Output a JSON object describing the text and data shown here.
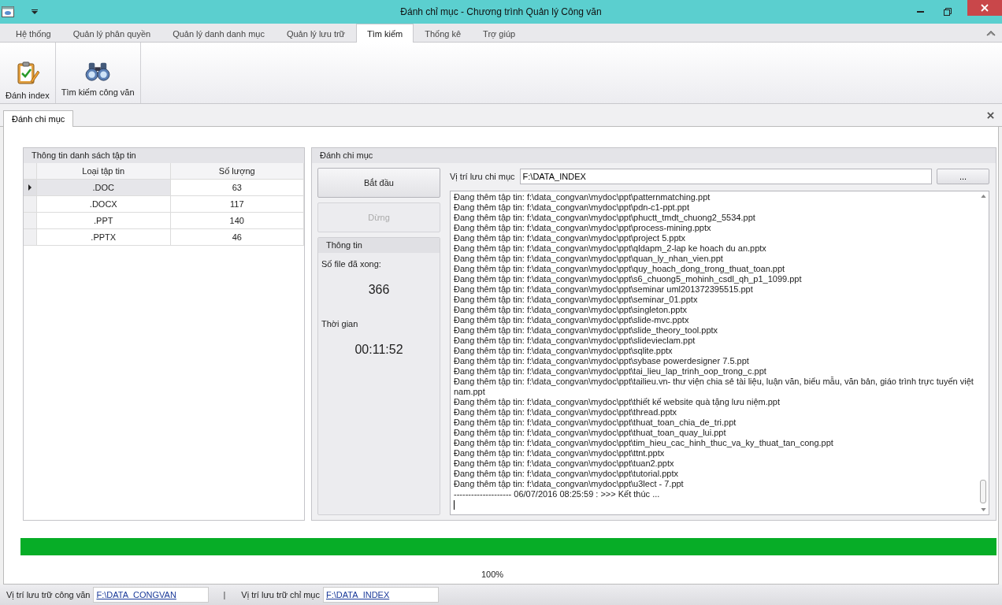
{
  "window": {
    "title": "Đánh chỉ mục - Chương trình Quản lý Công văn"
  },
  "menu_tabs": [
    {
      "label": "Hệ thống",
      "selected": false
    },
    {
      "label": "Quản lý phân quyền",
      "selected": false
    },
    {
      "label": "Quản lý danh danh mục",
      "selected": false
    },
    {
      "label": "Quản lý lưu trữ",
      "selected": false
    },
    {
      "label": "Tìm kiếm",
      "selected": true
    },
    {
      "label": "Thống kê",
      "selected": false
    },
    {
      "label": "Trợ giúp",
      "selected": false
    }
  ],
  "ribbon_buttons": [
    {
      "label": "Đánh index",
      "kind": "clipboard"
    },
    {
      "label": "Tìm kiếm công văn",
      "kind": "binoculars"
    }
  ],
  "document_tab": {
    "label": "Đánh chi mục"
  },
  "file_list": {
    "title": "Thông tin danh sách tập tin",
    "columns": [
      "Loại tập tin",
      "Số lượng"
    ],
    "rows": [
      {
        "cells": [
          ".DOC",
          "63"
        ],
        "selected": true
      },
      {
        "cells": [
          ".DOCX",
          "117"
        ],
        "selected": false
      },
      {
        "cells": [
          ".PPT",
          "140"
        ],
        "selected": false
      },
      {
        "cells": [
          ".PPTX",
          "46"
        ],
        "selected": false
      }
    ]
  },
  "indexing": {
    "title": "Đánh chi mục",
    "buttons": [
      {
        "label": "Bắt đầu",
        "disabled": false
      },
      {
        "label": "Dừng",
        "disabled": true
      }
    ],
    "info": {
      "title": "Thông tin",
      "files_label": "Số file đã xong:",
      "files_value": "366",
      "time_label": "Thời gian",
      "time_value": "00:11:52"
    },
    "location_label": "Vị trí lưu chi mục",
    "location_value": "F:\\DATA_INDEX",
    "browse_label": "...",
    "log": [
      "Đang thêm tập tin: f:\\data_congvan\\mydoc\\ppt\\patternmatching.ppt",
      "Đang thêm tập tin: f:\\data_congvan\\mydoc\\ppt\\pdn-c1-ppt.ppt",
      "Đang thêm tập tin: f:\\data_congvan\\mydoc\\ppt\\phuctt_tmdt_chuong2_5534.ppt",
      "Đang thêm tập tin: f:\\data_congvan\\mydoc\\ppt\\process-mining.pptx",
      "Đang thêm tập tin: f:\\data_congvan\\mydoc\\ppt\\project 5.pptx",
      "Đang thêm tập tin: f:\\data_congvan\\mydoc\\ppt\\qldapm_2-lap ke hoach du an.pptx",
      "Đang thêm tập tin: f:\\data_congvan\\mydoc\\ppt\\quan_ly_nhan_vien.ppt",
      "Đang thêm tập tin: f:\\data_congvan\\mydoc\\ppt\\quy_hoach_dong_trong_thuat_toan.ppt",
      "Đang thêm tập tin: f:\\data_congvan\\mydoc\\ppt\\s6_chuong5_mohinh_csdl_qh_p1_1099.ppt",
      "Đang thêm tập tin: f:\\data_congvan\\mydoc\\ppt\\seminar uml201372395515.ppt",
      "Đang thêm tập tin: f:\\data_congvan\\mydoc\\ppt\\seminar_01.pptx",
      "Đang thêm tập tin: f:\\data_congvan\\mydoc\\ppt\\singleton.pptx",
      "Đang thêm tập tin: f:\\data_congvan\\mydoc\\ppt\\slide-mvc.pptx",
      "Đang thêm tập tin: f:\\data_congvan\\mydoc\\ppt\\slide_theory_tool.pptx",
      "Đang thêm tập tin: f:\\data_congvan\\mydoc\\ppt\\slidevieclam.ppt",
      "Đang thêm tập tin: f:\\data_congvan\\mydoc\\ppt\\sqlite.pptx",
      "Đang thêm tập tin: f:\\data_congvan\\mydoc\\ppt\\sybase powerdesigner 7.5.ppt",
      "Đang thêm tập tin: f:\\data_congvan\\mydoc\\ppt\\tai_lieu_lap_trinh_oop_trong_c.ppt",
      "Đang thêm tập tin: f:\\data_congvan\\mydoc\\ppt\\tailieu.vn- thư viện chia sẻ tài liệu, luận văn, biểu mẫu, văn bản, giáo trình trực tuyến việt nam.ppt",
      "Đang thêm tập tin: f:\\data_congvan\\mydoc\\ppt\\thiết kế website quà tặng lưu niệm.ppt",
      "Đang thêm tập tin: f:\\data_congvan\\mydoc\\ppt\\thread.pptx",
      "Đang thêm tập tin: f:\\data_congvan\\mydoc\\ppt\\thuat_toan_chia_de_tri.ppt",
      "Đang thêm tập tin: f:\\data_congvan\\mydoc\\ppt\\thuat_toan_quay_lui.ppt",
      "Đang thêm tập tin: f:\\data_congvan\\mydoc\\ppt\\tim_hieu_cac_hinh_thuc_va_ky_thuat_tan_cong.ppt",
      "Đang thêm tập tin: f:\\data_congvan\\mydoc\\ppt\\ttnt.pptx",
      "Đang thêm tập tin: f:\\data_congvan\\mydoc\\ppt\\tuan2.pptx",
      "Đang thêm tập tin: f:\\data_congvan\\mydoc\\ppt\\tutorial.pptx",
      "Đang thêm tập tin: f:\\data_congvan\\mydoc\\ppt\\u3lect - 7.ppt",
      "-------------------- 06/07/2016 08:25:59 : >>> Kết thúc ..."
    ]
  },
  "progress": {
    "level": 1.0,
    "reading": "100%"
  },
  "status_bar": [
    {
      "label": "Vị trí lưu trữ công văn",
      "value": "F:\\DATA_CONGVAN"
    },
    {
      "label": "Vị trí lưu trữ chỉ mục",
      "value": "F:\\DATA_INDEX"
    }
  ],
  "status_separator": "|"
}
